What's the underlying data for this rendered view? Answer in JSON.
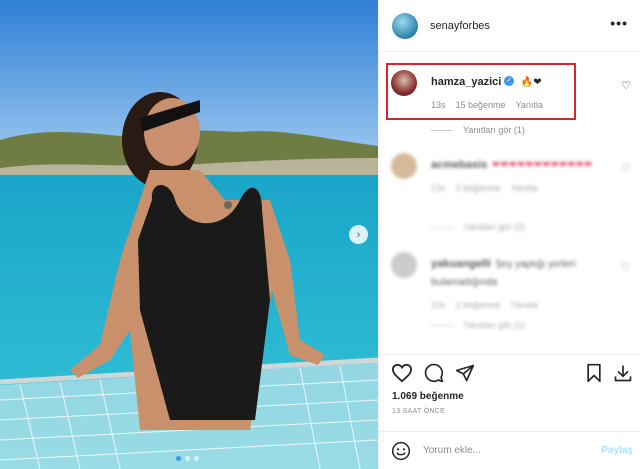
{
  "post": {
    "username": "senayforbes",
    "more_glyph": "•••",
    "next_glyph": "›",
    "likes": "1.069 beğenme",
    "time_ago": "13 SAAT ÖNCE"
  },
  "comments": [
    {
      "username": "hamza_yazici",
      "text_emoji": "🔥❤",
      "time": "13s",
      "likes": "15 beğenme",
      "reply": "Yanıtla",
      "view_replies": "Yanıtları gör (1)",
      "avatar_color": "#7a2a2a",
      "verified": true,
      "highlighted": true
    },
    {
      "username": "acmebasis",
      "text_emoji": "❤❤❤❤❤❤❤❤❤❤❤❤",
      "time": "13s",
      "likes": "3 beğenme",
      "reply": "Yanıtla",
      "view_replies": "Yanıtları gör (3)",
      "avatar_color": "#c9a27a",
      "blurred": true
    },
    {
      "username": "yakuangelli",
      "text": "Şey yaptığı yerleri bulamadığında",
      "time": "13s",
      "likes": "1 beğenme",
      "reply": "Yanıtla",
      "view_replies": "Yanıtları gör (1)",
      "avatar_color": "#bbbbbb",
      "blurred": true
    }
  ],
  "comment_input": {
    "placeholder": "Yorum ekle...",
    "submit_label": "Paylaş",
    "emoji_icon": "smiley-icon"
  },
  "icons": [
    "heart-icon",
    "comment-icon",
    "share-icon",
    "bookmark-icon",
    "download-icon"
  ],
  "colors": {
    "accent": "#3897f0",
    "highlight_border": "#d6262b",
    "muted_text": "#8e8e8e",
    "submit_disabled": "#b2dffc"
  }
}
